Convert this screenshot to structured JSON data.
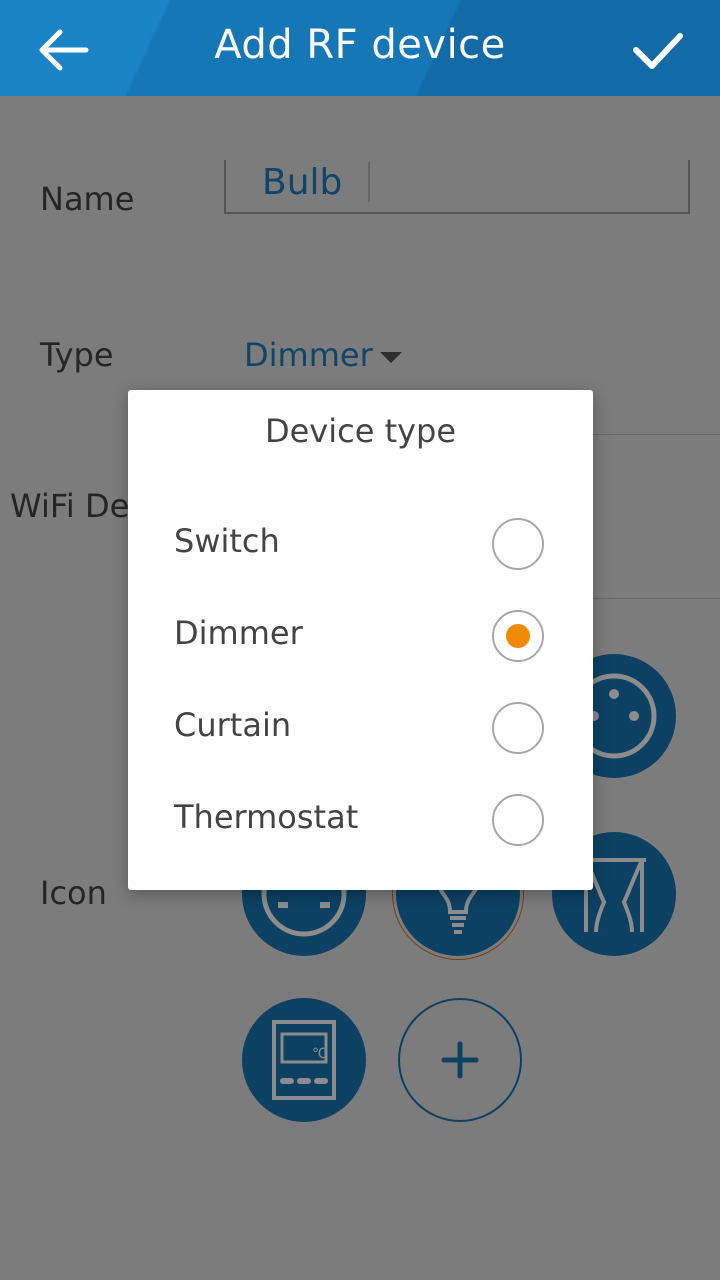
{
  "header": {
    "title": "Add RF device",
    "back_icon": "arrow-left-icon",
    "confirm_icon": "checkmark-icon",
    "color": "#1677b6"
  },
  "form": {
    "name_label": "Name",
    "name_value": "Bulb",
    "type_label": "Type",
    "type_value": "Dimmer",
    "wifi_label": "WiFi Dev",
    "icon_label": "Icon"
  },
  "icons": [
    {
      "name": "socket-icon"
    },
    {
      "name": "socket-plug-icon"
    },
    {
      "name": "bulb-icon",
      "selected": true
    },
    {
      "name": "curtain-icon"
    },
    {
      "name": "thermostat-icon",
      "text": "℃"
    },
    {
      "name": "add-icon"
    }
  ],
  "dialog": {
    "title": "Device type",
    "options": [
      {
        "label": "Switch",
        "selected": false
      },
      {
        "label": "Dimmer",
        "selected": true
      },
      {
        "label": "Curtain",
        "selected": false
      },
      {
        "label": "Thermostat",
        "selected": false
      }
    ],
    "accent": "#f08a00"
  }
}
